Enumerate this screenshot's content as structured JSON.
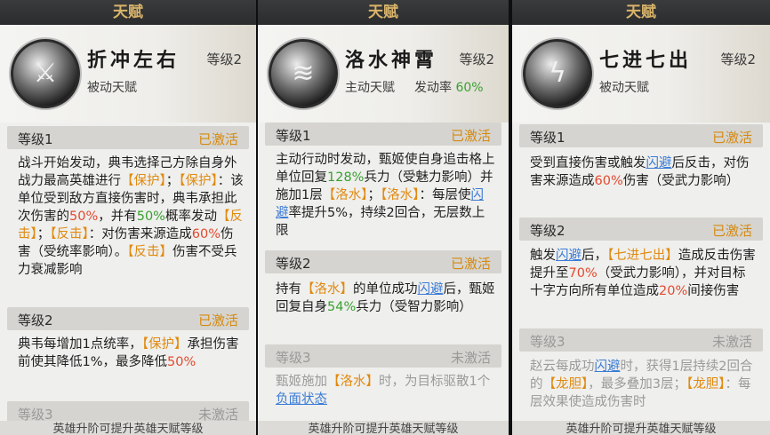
{
  "panels": [
    {
      "banner": "天赋",
      "icon": "shield-warrior-icon",
      "name": "折冲左右",
      "level": "等级2",
      "type": "被动天赋",
      "tiers": [
        {
          "label": "等级1",
          "status": "已激活"
        },
        {
          "label": "等级2",
          "status": "已激活"
        },
        {
          "label": "等级3",
          "status": "未激活"
        }
      ],
      "t1": {
        "a": "战斗开始发动，典韦选择己方除自身外战力最高英雄进行",
        "b": "【保护】",
        "c": "；",
        "d": "【保护】",
        "e": "：该单位受到敌方直接伤害时，典韦承担此次伤害的",
        "f": "50%",
        "g": "，并有",
        "h": "50%",
        "i": "概率发动",
        "j": "【反击】",
        "k": "；",
        "l": "【反击】",
        "m": "：对伤害来源造成",
        "n": "60%",
        "o": "伤害（受统率影响）。",
        "p": "【反击】",
        "q": "伤害不受兵力衰减影响"
      },
      "t2": {
        "a": "典韦每增加1点统率，",
        "b": "【保护】",
        "c": "承担伤害前使其降低1%，最多降低",
        "d": "50%"
      },
      "footer": "英雄升阶可提升英雄天赋等级"
    },
    {
      "banner": "天赋",
      "icon": "water-swirl-icon",
      "name": "洛水神霄",
      "level": "等级2",
      "type": "主动天赋",
      "rate_label": "发动率",
      "rate_value": "60%",
      "tiers": [
        {
          "label": "等级1",
          "status": "已激活"
        },
        {
          "label": "等级2",
          "status": "已激活"
        },
        {
          "label": "等级3",
          "status": "未激活"
        }
      ],
      "t1": {
        "a": "主动行动时发动，甄姬使自身追击格上单位回复",
        "b": "128%",
        "c": "兵力（受魅力影响）并施加1层",
        "d": "【洛水】",
        "e": "；",
        "f": "【洛水】",
        "g": "：每层使",
        "h": "闪避",
        "i": "率提升5%，持续2回合，无层数上限"
      },
      "t2": {
        "a": "持有",
        "b": "【洛水】",
        "c": "的单位成功",
        "d": "闪避",
        "e": "后，甄姬回复自身",
        "f": "54%",
        "g": "兵力（受智力影响）"
      },
      "t3": {
        "a": "甄姬施加",
        "b": "【洛水】",
        "c": "时，为目标驱散1个",
        "d": "负面状态"
      },
      "footer": "英雄升阶可提升英雄天赋等级"
    },
    {
      "banner": "天赋",
      "icon": "lightning-icon",
      "name": "七进七出",
      "level": "等级2",
      "type": "被动天赋",
      "tiers": [
        {
          "label": "等级1",
          "status": "已激活"
        },
        {
          "label": "等级2",
          "status": "已激活"
        },
        {
          "label": "等级3",
          "status": "未激活"
        }
      ],
      "t1": {
        "a": "受到直接伤害或触发",
        "b": "闪避",
        "c": "后反击，对伤害来源造成",
        "d": "60%",
        "e": "伤害（受武力影响）"
      },
      "t2": {
        "a": "触发",
        "b": "闪避",
        "c": "后，",
        "d": "【七进七出】",
        "e": "造成反击伤害提升至",
        "f": "70%",
        "g": "（受武力影响），并对目标十字方向所有单位造成",
        "h": "20%",
        "i": "间接伤害"
      },
      "t3": {
        "a": "赵云每成功",
        "b": "闪避",
        "c": "时，获得1层持续2回合的",
        "d": "【龙胆】",
        "e": "，最多叠加3层；",
        "f": "【龙胆】",
        "g": "：每层效果使造成伤害时"
      },
      "footer": "英雄升阶可提升英雄天赋等级"
    }
  ]
}
